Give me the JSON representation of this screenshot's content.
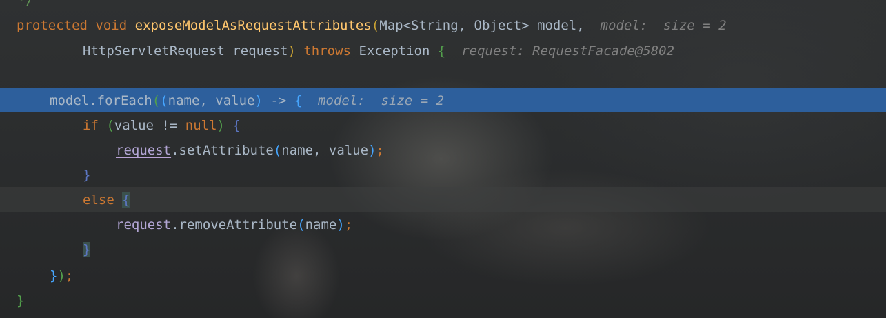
{
  "editor": {
    "line_0": {
      "comment_tail": "*/"
    },
    "line_1": {
      "kw_protected": "protected",
      "kw_void": "void",
      "method_name": "exposeModelAsRequestAttributes",
      "paren_open": "(",
      "type_map": "Map<String, Object>",
      "param_model": "model,",
      "hint": "model:  size = 2"
    },
    "line_2": {
      "type_request": "HttpServletRequest",
      "param_request": "request",
      "paren_close": ")",
      "kw_throws": "throws",
      "type_exception": "Exception",
      "brace_open": "{",
      "hint": "request: RequestFacade@5802"
    },
    "line_4": {
      "call_prefix": "model.forEach",
      "paren_open": "(",
      "lambda_paren_open": "(",
      "lambda_params": "name, value",
      "lambda_paren_close": ")",
      "arrow": "->",
      "brace_open": "{",
      "hint": "model:  size = 2"
    },
    "line_5": {
      "kw_if": "if",
      "paren_open": "(",
      "condition_left": "value != ",
      "kw_null": "null",
      "paren_close": ")",
      "brace_open": "{"
    },
    "line_6": {
      "var_request": "request",
      "call": ".setAttribute",
      "paren_open": "(",
      "args": "name, value",
      "paren_close": ")",
      "semicolon": ";"
    },
    "line_7": {
      "brace_close": "}"
    },
    "line_8": {
      "kw_else": "else",
      "brace_open": "{"
    },
    "line_9": {
      "var_request": "request",
      "call": ".removeAttribute",
      "paren_open": "(",
      "args": "name",
      "paren_close": ")",
      "semicolon": ";"
    },
    "line_10": {
      "brace_close": "}"
    },
    "line_11": {
      "brace_close": "}",
      "paren_close": ")",
      "semicolon": ";"
    },
    "line_12": {
      "brace_close": "}"
    }
  },
  "colors": {
    "keyword": "#cc7832",
    "method": "#ffc66d",
    "text": "#a9b7c6",
    "inline_hint": "#808080",
    "execution_line": "#2d5f9c",
    "field_var": "#b2a5d4"
  }
}
